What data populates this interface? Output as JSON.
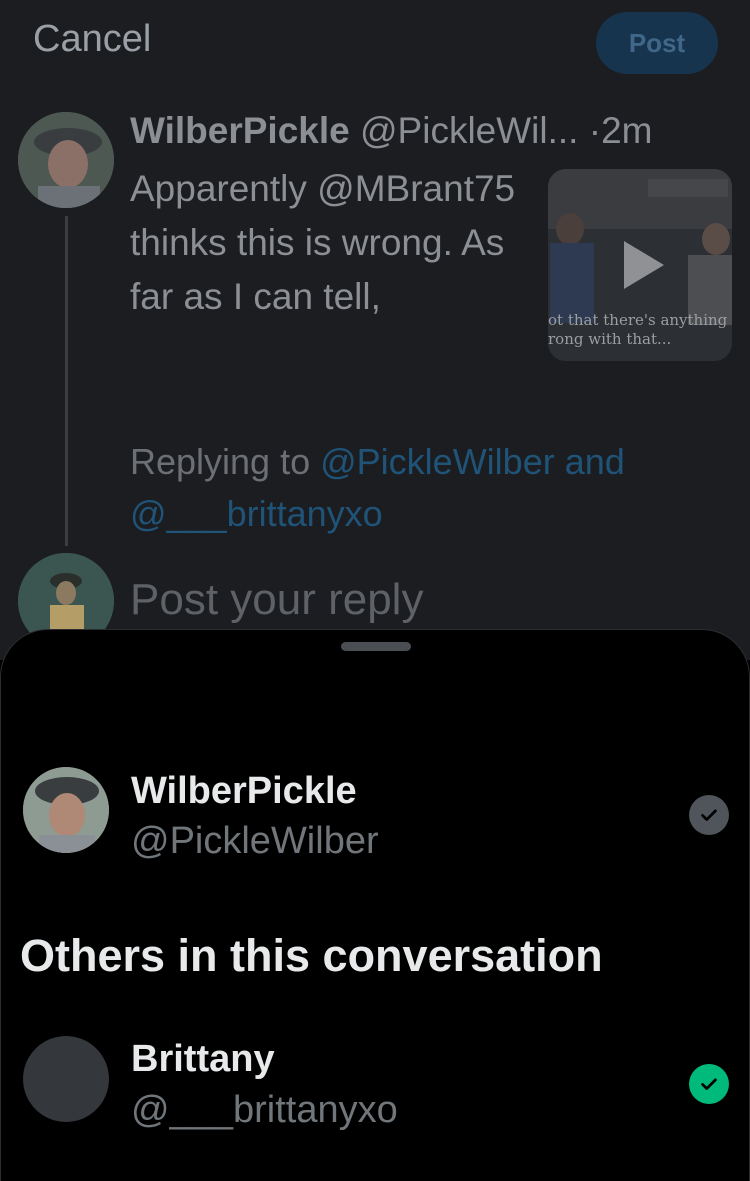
{
  "composer": {
    "cancel_label": "Cancel",
    "post_label": "Post",
    "tweet": {
      "display_name": "WilberPickle",
      "handle": "@PickleWil...",
      "separator": "·",
      "time": "2m",
      "text": "Apparently @MBrant75 thinks this is wrong. As far as I can tell,",
      "media_caption_line1": "ot that there's anything",
      "media_caption_line2": "rong with that..."
    },
    "replying_prefix": "Replying to",
    "replying_handles": "@PickleWilber and @___brittanyxo",
    "reply_placeholder": "Post your reply"
  },
  "sheet": {
    "author": {
      "display_name": "WilberPickle",
      "handle": "@PickleWilber",
      "checked": true
    },
    "others_title": "Others in this conversation",
    "others": [
      {
        "display_name": "Brittany",
        "handle": "@___brittanyxo",
        "checked": true
      }
    ]
  },
  "colors": {
    "accent_green": "#00ba7c",
    "link_dim": "#1f5377",
    "sheet_bg": "#000000"
  },
  "icons": {
    "check": "checkmark-icon",
    "play": "play-icon"
  }
}
